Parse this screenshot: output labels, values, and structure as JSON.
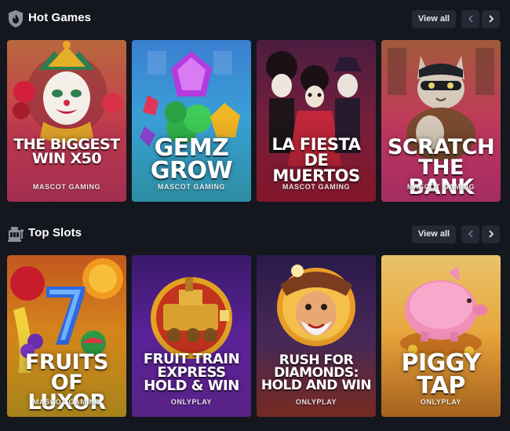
{
  "sections": [
    {
      "title": "Hot Games",
      "icon": "fire-shield-icon",
      "view_all_label": "View all",
      "games": [
        {
          "title": "THE BIGGEST WIN X50",
          "provider": "MASCOT GAMING"
        },
        {
          "title": "GEMZ GROW",
          "provider": "MASCOT GAMING"
        },
        {
          "title": "LA FIESTA DE MUERTOS",
          "provider": "MASCOT GAMING"
        },
        {
          "title": "SCRATCH THE BANK",
          "provider": "MASCOT GAMING"
        }
      ]
    },
    {
      "title": "Top Slots",
      "icon": "slot-machine-icon",
      "view_all_label": "View all",
      "games": [
        {
          "title": "FRUITS OF LUXOR",
          "provider": "MASCOT GAMING"
        },
        {
          "title": "FRUIT TRAIN EXPRESS HOLD & WIN",
          "provider": "ONLYPLAY"
        },
        {
          "title": "RUSH FOR DIAMONDS: HOLD AND WIN",
          "provider": "ONLYPLAY"
        },
        {
          "title": "PIGGY TAP",
          "provider": "ONLYPLAY"
        }
      ]
    }
  ],
  "colors": {
    "background": "#15171f",
    "button": "#262935"
  }
}
